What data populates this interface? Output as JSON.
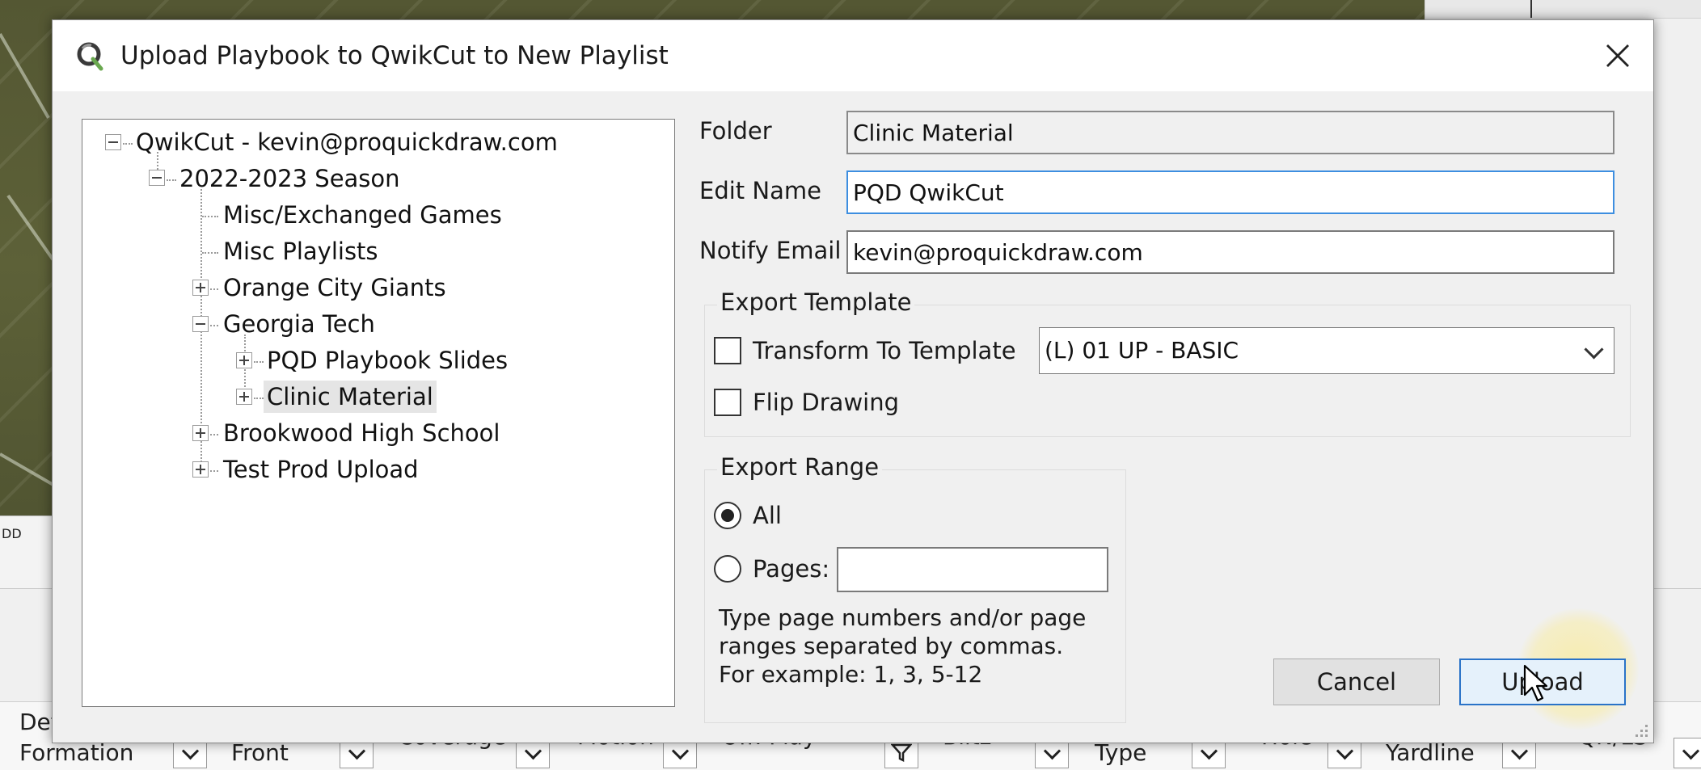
{
  "background": {
    "left_strip_text": "DD",
    "filters": [
      {
        "label": "Det",
        "label2": "Formation"
      },
      {
        "label": "Front"
      },
      {
        "label": "Coverage"
      },
      {
        "label": "Motion"
      },
      {
        "label": "Off. Play"
      },
      {
        "label": "Blitz"
      },
      {
        "label": "Type"
      },
      {
        "label": "Hole"
      },
      {
        "label": "Yardline"
      },
      {
        "label": "QN/LS"
      }
    ]
  },
  "dialog": {
    "title": "Upload Playbook to QwikCut to New Playlist",
    "tree": {
      "root": "QwikCut - kevin@proquickdraw.com",
      "season": "2022-2023 Season",
      "items": [
        "Misc/Exchanged Games",
        "Misc Playlists",
        "Orange City Giants",
        "Georgia Tech",
        "PQD Playbook Slides",
        "Clinic Material",
        "Brookwood High School",
        "Test Prod Upload"
      ],
      "selected": "Clinic Material"
    },
    "form": {
      "folder_label": "Folder",
      "folder_value": "Clinic Material",
      "edit_name_label": "Edit Name",
      "edit_name_value": "PQD QwikCut",
      "notify_email_label": "Notify Email",
      "notify_email_value": "kevin@proquickdraw.com",
      "export_template": {
        "group_label": "Export Template",
        "transform_label": "Transform To Template",
        "transform_checked": false,
        "template_value": "(L) 01 UP - BASIC",
        "flip_label": "Flip Drawing",
        "flip_checked": false
      },
      "export_range": {
        "group_label": "Export Range",
        "all_label": "All",
        "pages_label": "Pages:",
        "pages_value": "",
        "selected": "All",
        "hint_line1": "Type page numbers and/or page",
        "hint_line2": "ranges separated by commas.",
        "hint_line3": "For example: 1, 3, 5-12"
      }
    },
    "buttons": {
      "cancel": "Cancel",
      "upload": "Upload"
    }
  },
  "colors": {
    "accent": "#2a73c8",
    "focus_border": "#3d8ee0",
    "dialog_bg": "#f0f0f0"
  }
}
